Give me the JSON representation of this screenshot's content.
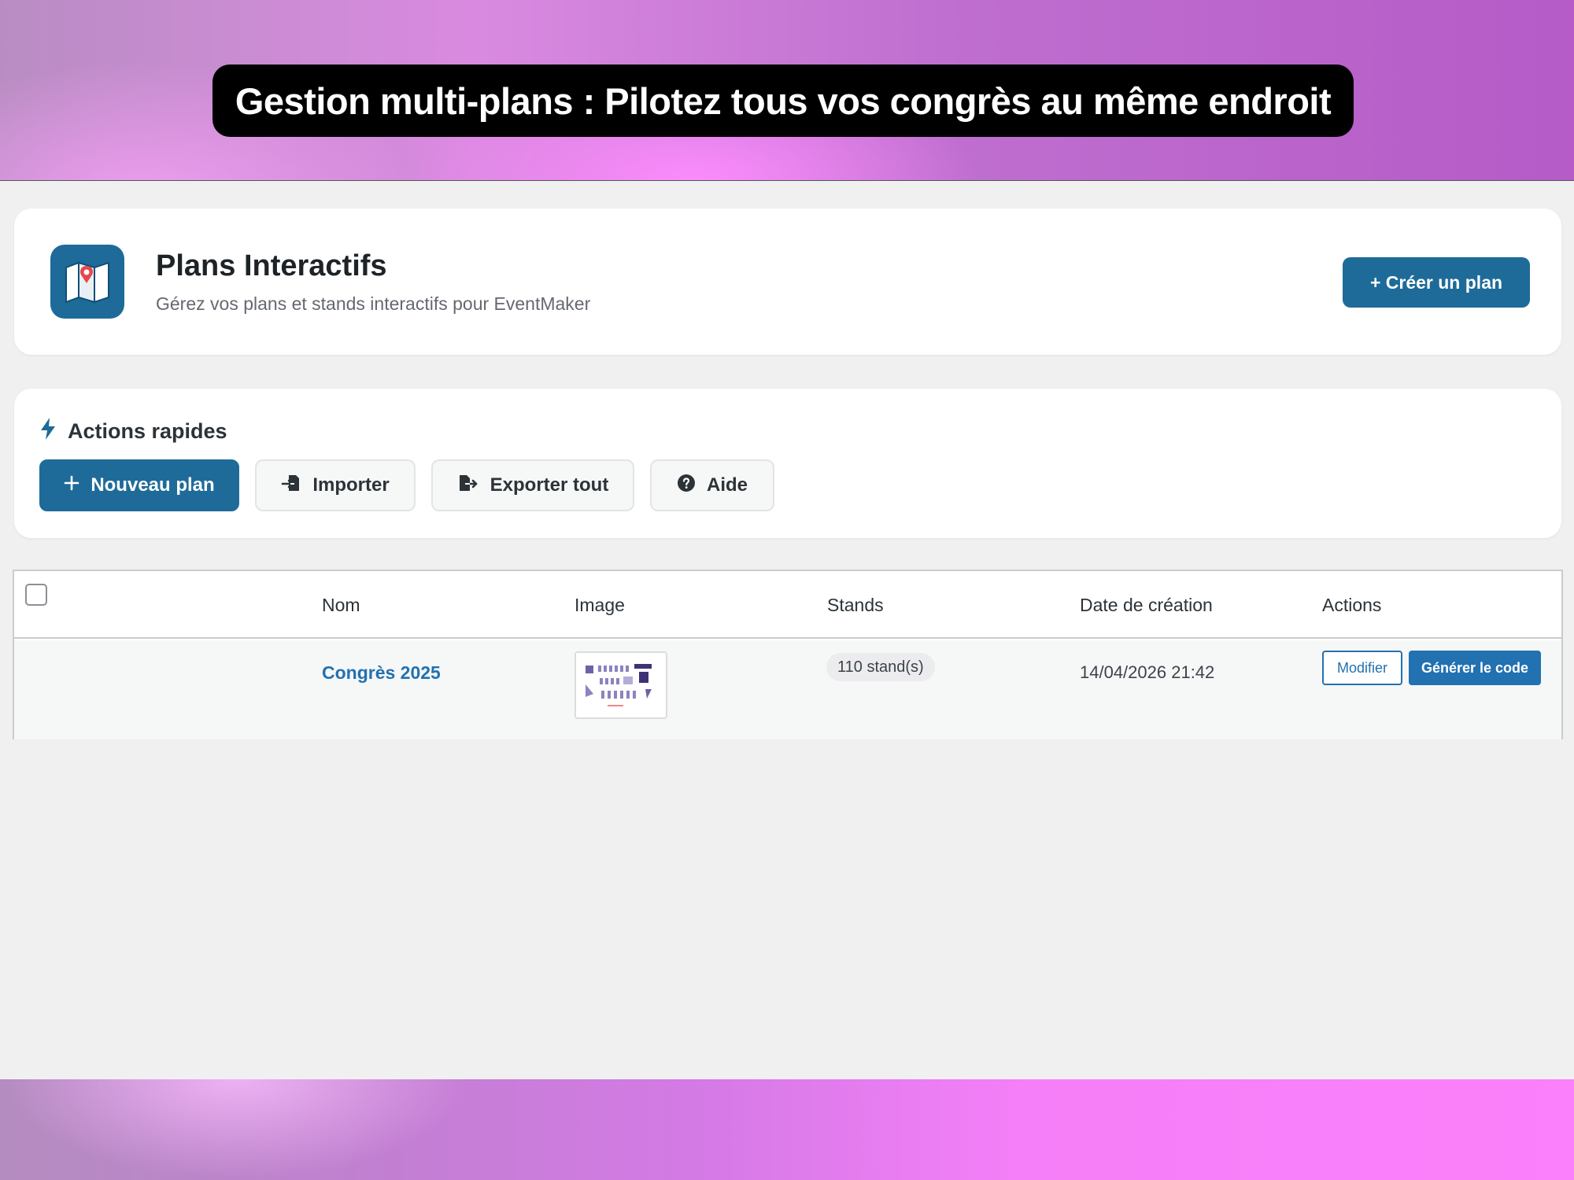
{
  "banner": {
    "title": "Gestion multi-plans : Pilotez tous vos congrès au même endroit"
  },
  "header": {
    "icon": "map-icon",
    "title": "Plans Interactifs",
    "subtitle": "Gérez vos plans et stands interactifs pour EventMaker",
    "create_label": "+ Créer un plan"
  },
  "quick_actions": {
    "title": "Actions rapides",
    "icon": "bolt-icon",
    "buttons": [
      {
        "label": "Nouveau plan",
        "icon": "plus-icon"
      },
      {
        "label": "Importer",
        "icon": "import-icon"
      },
      {
        "label": "Exporter tout",
        "icon": "export-icon"
      },
      {
        "label": "Aide",
        "icon": "help-icon"
      }
    ]
  },
  "table": {
    "columns": [
      "Nom",
      "Image",
      "Stands",
      "Date de création",
      "Actions"
    ],
    "rows": [
      {
        "name": "Congrès 2025",
        "stands": "110 stand(s)",
        "date": "14/04/2026 21:42",
        "edit_label": "Modifier",
        "code_label": "Générer le code"
      }
    ]
  },
  "colors": {
    "primary": "#1e6b99",
    "link": "#2271b1",
    "background": "#f0f0f1"
  }
}
